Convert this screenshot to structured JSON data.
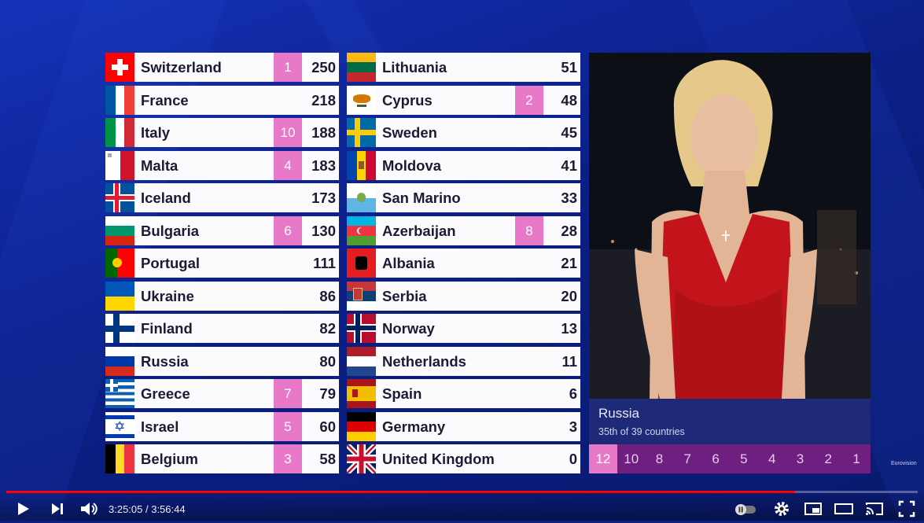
{
  "colors": {
    "accent": "#e879c8",
    "points_bar": "#6e1f7f",
    "info_bg": "#1e2a78",
    "progress": "#ff0000"
  },
  "left_column": [
    {
      "country": "Switzerland",
      "points": "1",
      "total": "250",
      "flag": "switzerland"
    },
    {
      "country": "France",
      "points": "",
      "total": "218",
      "flag": "france"
    },
    {
      "country": "Italy",
      "points": "10",
      "total": "188",
      "flag": "italy"
    },
    {
      "country": "Malta",
      "points": "4",
      "total": "183",
      "flag": "malta"
    },
    {
      "country": "Iceland",
      "points": "",
      "total": "173",
      "flag": "iceland"
    },
    {
      "country": "Bulgaria",
      "points": "6",
      "total": "130",
      "flag": "bulgaria"
    },
    {
      "country": "Portugal",
      "points": "",
      "total": "111",
      "flag": "portugal"
    },
    {
      "country": "Ukraine",
      "points": "",
      "total": "86",
      "flag": "ukraine"
    },
    {
      "country": "Finland",
      "points": "",
      "total": "82",
      "flag": "finland"
    },
    {
      "country": "Russia",
      "points": "",
      "total": "80",
      "flag": "russia"
    },
    {
      "country": "Greece",
      "points": "7",
      "total": "79",
      "flag": "greece"
    },
    {
      "country": "Israel",
      "points": "5",
      "total": "60",
      "flag": "israel"
    },
    {
      "country": "Belgium",
      "points": "3",
      "total": "58",
      "flag": "belgium"
    }
  ],
  "right_column": [
    {
      "country": "Lithuania",
      "points": "",
      "total": "51",
      "flag": "lithuania"
    },
    {
      "country": "Cyprus",
      "points": "2",
      "total": "48",
      "flag": "cyprus"
    },
    {
      "country": "Sweden",
      "points": "",
      "total": "45",
      "flag": "sweden"
    },
    {
      "country": "Moldova",
      "points": "",
      "total": "41",
      "flag": "moldova"
    },
    {
      "country": "San Marino",
      "points": "",
      "total": "33",
      "flag": "san-marino"
    },
    {
      "country": "Azerbaijan",
      "points": "8",
      "total": "28",
      "flag": "azerbaijan"
    },
    {
      "country": "Albania",
      "points": "",
      "total": "21",
      "flag": "albania"
    },
    {
      "country": "Serbia",
      "points": "",
      "total": "20",
      "flag": "serbia"
    },
    {
      "country": "Norway",
      "points": "",
      "total": "13",
      "flag": "norway"
    },
    {
      "country": "Netherlands",
      "points": "",
      "total": "11",
      "flag": "netherlands"
    },
    {
      "country": "Spain",
      "points": "",
      "total": "6",
      "flag": "spain"
    },
    {
      "country": "Germany",
      "points": "",
      "total": "3",
      "flag": "germany"
    },
    {
      "country": "United Kingdom",
      "points": "",
      "total": "0",
      "flag": "united-kingdom"
    }
  ],
  "spokesperson": {
    "country": "Russia",
    "rank_text": "35th of 39 countries"
  },
  "points_sequence": [
    {
      "value": "12",
      "active": true
    },
    {
      "value": "10",
      "active": false
    },
    {
      "value": "8",
      "active": false
    },
    {
      "value": "7",
      "active": false
    },
    {
      "value": "6",
      "active": false
    },
    {
      "value": "5",
      "active": false
    },
    {
      "value": "4",
      "active": false
    },
    {
      "value": "3",
      "active": false
    },
    {
      "value": "2",
      "active": false
    },
    {
      "value": "1",
      "active": false
    }
  ],
  "player": {
    "current_time": "3:25:05",
    "duration": "3:56:44",
    "time_display": "3:25:05 / 3:56:44",
    "progress_fraction": 0.865
  },
  "logo_text": "Eurovision"
}
